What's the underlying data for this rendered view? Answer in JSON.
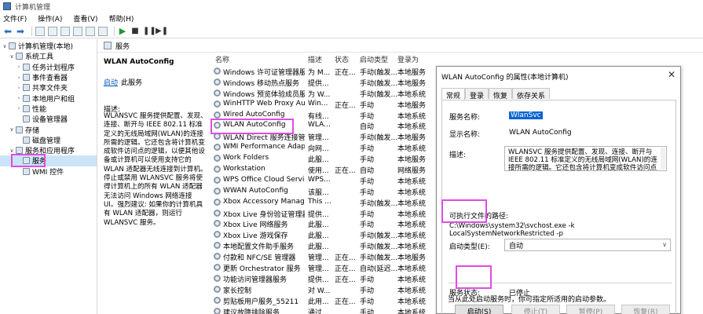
{
  "window": {
    "title": "计算机管理"
  },
  "menu": [
    "文件(F)",
    "操作(A)",
    "查看(V)",
    "帮助(H)"
  ],
  "tree": [
    {
      "label": "计算机管理(本地)",
      "level": 0,
      "tw": "v"
    },
    {
      "label": "系统工具",
      "level": 1,
      "tw": "v"
    },
    {
      "label": "任务计划程序",
      "level": 2,
      "tw": ">"
    },
    {
      "label": "事件查看器",
      "level": 2,
      "tw": ">"
    },
    {
      "label": "共享文件夹",
      "level": 2,
      "tw": ">"
    },
    {
      "label": "本地用户和组",
      "level": 2,
      "tw": ">"
    },
    {
      "label": "性能",
      "level": 2,
      "tw": ">"
    },
    {
      "label": "设备管理器",
      "level": 2,
      "tw": ""
    },
    {
      "label": "存储",
      "level": 1,
      "tw": "v"
    },
    {
      "label": "磁盘管理",
      "level": 2,
      "tw": ""
    },
    {
      "label": "服务和应用程序",
      "level": 1,
      "tw": "v"
    },
    {
      "label": "服务",
      "level": 2,
      "tw": "",
      "selected": true
    },
    {
      "label": "WMI 控件",
      "level": 2,
      "tw": ""
    }
  ],
  "header": {
    "title": "服务"
  },
  "desc_pane": {
    "service_title": "WLAN AutoConfig",
    "start_link": "启动",
    "start_rest": "此服务",
    "desc_label": "描述:",
    "desc_text": "WLANSVC 服务提供配置、发现、连接、断开与 IEEE 802.11 标准定义的无线局域网(WLAN)的连接所需的逻辑。它还包含将计算机变成软件访问点的逻辑，以便其他设备或计算机可以使用支持它的 WLAN 适配器无线连接到计算机。停止或禁用 WLANSVC 服务将使得计算机上的所有 WLAN 适配器无法访问 Windows 网络连接 UI。强烈建议: 如果你的计算机具有 WLAN 适配器，则运行 WLANSVC 服务。"
  },
  "list": {
    "columns": [
      "名称",
      "描述",
      "状态",
      "启动类型",
      "登录为"
    ],
    "rows": [
      [
        "Windows 许可证管理器服务",
        "为 M...",
        "正在...",
        "手动(触发...",
        "本地服务"
      ],
      [
        "Windows 移动热点服务",
        "提供...",
        "",
        "手动(触发...",
        "本地服务"
      ],
      [
        "Windows 预览体验成员服务",
        "为 W...",
        "",
        "手动(触发...",
        "本地系统"
      ],
      [
        "WinHTTP Web Proxy Aut...",
        "Win...",
        "正在...",
        "手动",
        "本地服务"
      ],
      [
        "Wired AutoConfig",
        "有线...",
        "",
        "手动",
        "本地系统"
      ],
      [
        "WLAN AutoConfig",
        "WLA...",
        "",
        "自动",
        "本地系统"
      ],
      [
        "WLAN Direct 服务连接管...",
        "管理...",
        "",
        "手动(触发...",
        "本地服务"
      ],
      [
        "WMI Performance Adapt...",
        "向网...",
        "",
        "手动",
        "本地系统"
      ],
      [
        "Work Folders",
        "此服...",
        "",
        "手动",
        "本地服务"
      ],
      [
        "Workstation",
        "使用...",
        "正在...",
        "自动",
        "网络服务"
      ],
      [
        "WPS Office Cloud Service",
        "WPS...",
        "",
        "手动",
        "本地系统"
      ],
      [
        "WWAN AutoConfig",
        "该服...",
        "",
        "手动",
        "本地系统"
      ],
      [
        "Xbox Accessory Manage...",
        "This ...",
        "",
        "手动(触发...",
        "本地系统"
      ],
      [
        "Xbox Live 身份验证管理器",
        "提供...",
        "",
        "手动",
        "本地系统"
      ],
      [
        "Xbox Live 网络服务",
        "此服...",
        "",
        "手动",
        "本地系统"
      ],
      [
        "Xbox Live 游戏保存",
        "此服...",
        "",
        "手动(触发...",
        "本地系统"
      ],
      [
        "本地配置文件助手服务",
        "此服...",
        "",
        "手动(触发...",
        "本地系统"
      ],
      [
        "付款和 NFC/SE 管理器",
        "管理...",
        "正在...",
        "手动(触发...",
        "本地服务"
      ],
      [
        "更新 Orchestrator 服务",
        "管理...",
        "正在...",
        "自动(延迟...",
        "本地系统"
      ],
      [
        "功能访问管理器服务",
        "提供...",
        "正在...",
        "手动",
        "本地系统"
      ],
      [
        "家长控制",
        "对 W...",
        "",
        "手动",
        "本地系统"
      ],
      [
        "剪贴板用户服务_55211",
        "此用...",
        "正在...",
        "手动",
        "本地系统"
      ],
      [
        "建议故障排除服务",
        "通过...",
        "",
        "手动",
        "本地系统"
      ]
    ]
  },
  "dialog": {
    "title": "WLAN AutoConfig 的属性(本地计算机)",
    "tabs": [
      "常规",
      "登录",
      "恢复",
      "依存关系"
    ],
    "service_name_label": "服务名称:",
    "service_name": "WlanSvc",
    "display_name_label": "显示名称:",
    "display_name": "WLAN AutoConfig",
    "desc_label": "描述:",
    "desc_text": "WLANSVC 服务提供配置、发现、连接、断开与 IEEE 802.11 标准定义的无线局域网(WLAN)的连接所需的逻辑。它还包含将计算机变成软件访问点的逻辑，以便",
    "path_label": "可执行文件的路径:",
    "path": "C:\\Windows\\system32\\svchost.exe -k LocalSystemNetworkRestricted -p",
    "startup_label": "启动类型(E):",
    "startup_value": "自动",
    "status_label": "服务状态:",
    "status_value": "已停止",
    "buttons": {
      "start": "启动(S)",
      "stop": "停止(T)",
      "pause": "暂停(P)",
      "resume": "恢复(R)"
    },
    "hint": "当从此处启动服务时，你可指定所适用的启动参数。"
  }
}
